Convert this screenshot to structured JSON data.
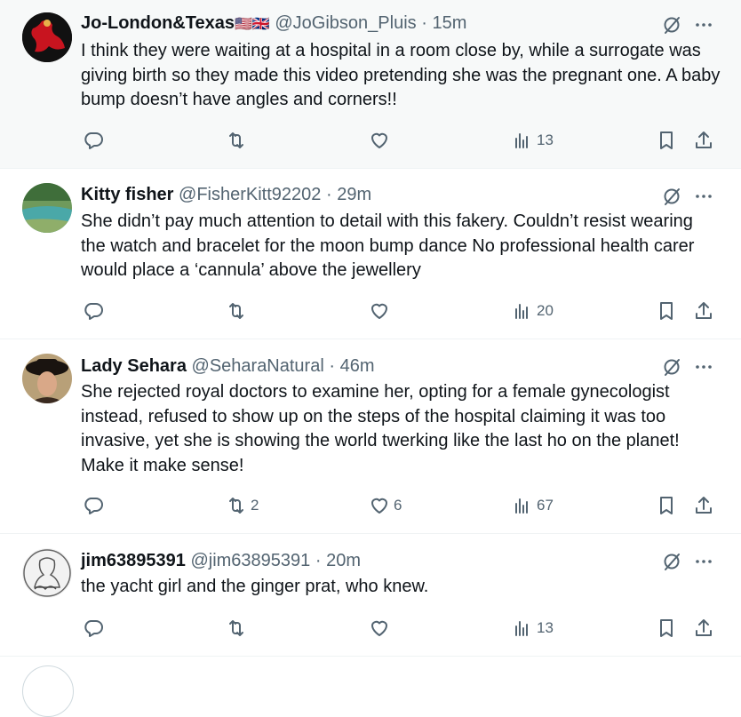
{
  "tweets": [
    {
      "name": "Jo-London&Texas",
      "flags": "🇺🇸🇬🇧",
      "handle": "@JoGibson_Pluis",
      "sep": "·",
      "time": "15m",
      "text": "I think they were waiting at a hospital in a room close by, while a surrogate was giving birth so they made this video pretending she was the pregnant one.  A baby bump doesn’t have angles and corners!!",
      "replies": "",
      "reposts": "",
      "likes": "",
      "views": "13",
      "avatar_color": "#b3101b"
    },
    {
      "name": "Kitty fisher",
      "handle": "@FisherKitt92202",
      "sep": "·",
      "time": "29m",
      "text": "She didn’t pay much attention to detail with this fakery.  Couldn’t resist wearing the watch and bracelet for the moon bump dance No professional health carer would place  a ‘cannula’ above the jewellery",
      "replies": "",
      "reposts": "",
      "likes": "",
      "views": "20",
      "avatar_color": "#5b8a52"
    },
    {
      "name": "Lady Sehara",
      "handle": "@SeharaNatural",
      "sep": "·",
      "time": "46m",
      "text": "She rejected royal doctors to examine her, opting for a female gynecologist instead, refused to show up on the steps of the hospital claiming it was too invasive, yet she is showing the world twerking like the last ho on the planet! Make it make sense!",
      "replies": "",
      "reposts": "2",
      "likes": "6",
      "views": "67",
      "avatar_color": "#6e4a2e"
    },
    {
      "name": "jim63895391",
      "handle": "@jim63895391",
      "sep": "·",
      "time": "20m",
      "text": "the yacht girl and the ginger prat, who knew.",
      "replies": "",
      "reposts": "",
      "likes": "",
      "views": "13",
      "avatar_color": "#d9d9d9"
    }
  ],
  "colors": {
    "text": "#0f1419",
    "secondary": "#536471",
    "hover_bg": "#f7f9f9",
    "divider": "#eff3f4"
  },
  "icons": [
    "reply-icon",
    "repost-icon",
    "like-icon",
    "views-icon",
    "bookmark-icon",
    "share-icon",
    "grok-icon",
    "more-icon"
  ]
}
